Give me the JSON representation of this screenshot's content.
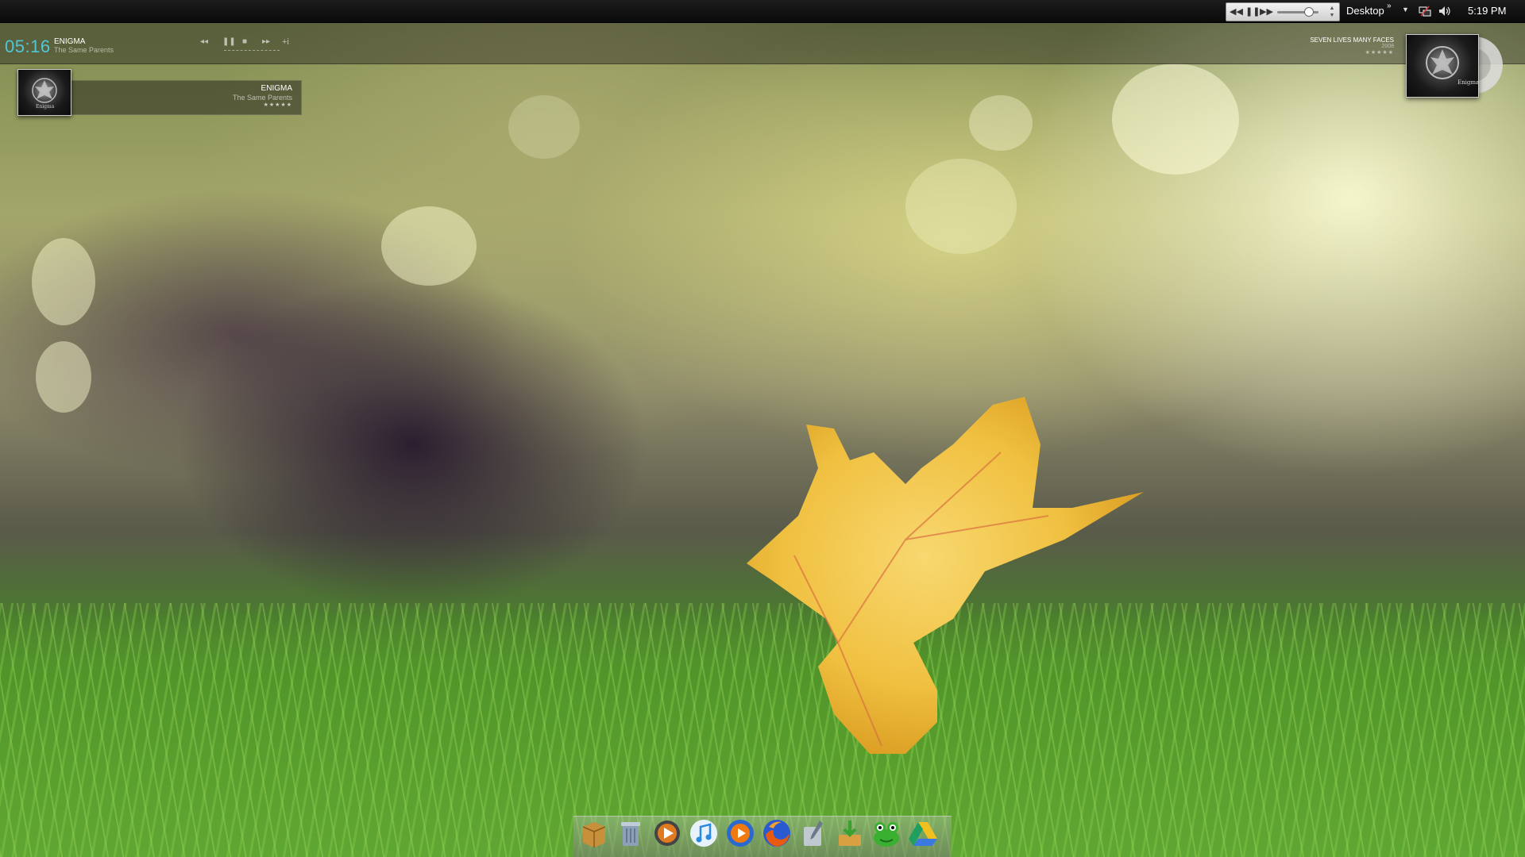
{
  "taskbar": {
    "desktop_label": "Desktop",
    "clock": "5:19 PM",
    "mini_player": {
      "buttons": [
        "previous-icon",
        "pause-icon",
        "next-icon"
      ],
      "volume": 0.75
    },
    "tray_icons": [
      "network-icon",
      "volume-icon"
    ]
  },
  "now_playing_bar": {
    "elapsed": "05:16",
    "artist": "ENIGMA",
    "track": "The Same Parents",
    "controls": [
      "previous-icon",
      "pause-icon",
      "stop-icon",
      "next-icon",
      "info-icon"
    ],
    "info_label": "+i"
  },
  "album_widget": {
    "album_title": "SEVEN LIVES MANY FACES",
    "year": "2008",
    "rating": "★★★★★",
    "cover_text": "Enigma"
  },
  "now_playing_panel": {
    "artist": "ENIGMA",
    "track": "The Same Parents",
    "rating": "★★★★★",
    "cover_text": "Enigma"
  },
  "dock": {
    "items": [
      {
        "name": "package-icon",
        "color": "#c8903a"
      },
      {
        "name": "recycle-bin-icon",
        "color": "#8ca0b8"
      },
      {
        "name": "media-player-icon",
        "color": "#e07a20"
      },
      {
        "name": "itunes-icon",
        "color": "#2a8ae0"
      },
      {
        "name": "windows-media-player-icon",
        "color": "#f07a10"
      },
      {
        "name": "firefox-icon",
        "color": "#2a5ad0"
      },
      {
        "name": "pen-tool-icon",
        "color": "#c0c8d0"
      },
      {
        "name": "download-icon",
        "color": "#d8a040"
      },
      {
        "name": "frog-messenger-icon",
        "color": "#3ab030"
      },
      {
        "name": "google-drive-icon",
        "color": "#f0c020"
      }
    ]
  }
}
